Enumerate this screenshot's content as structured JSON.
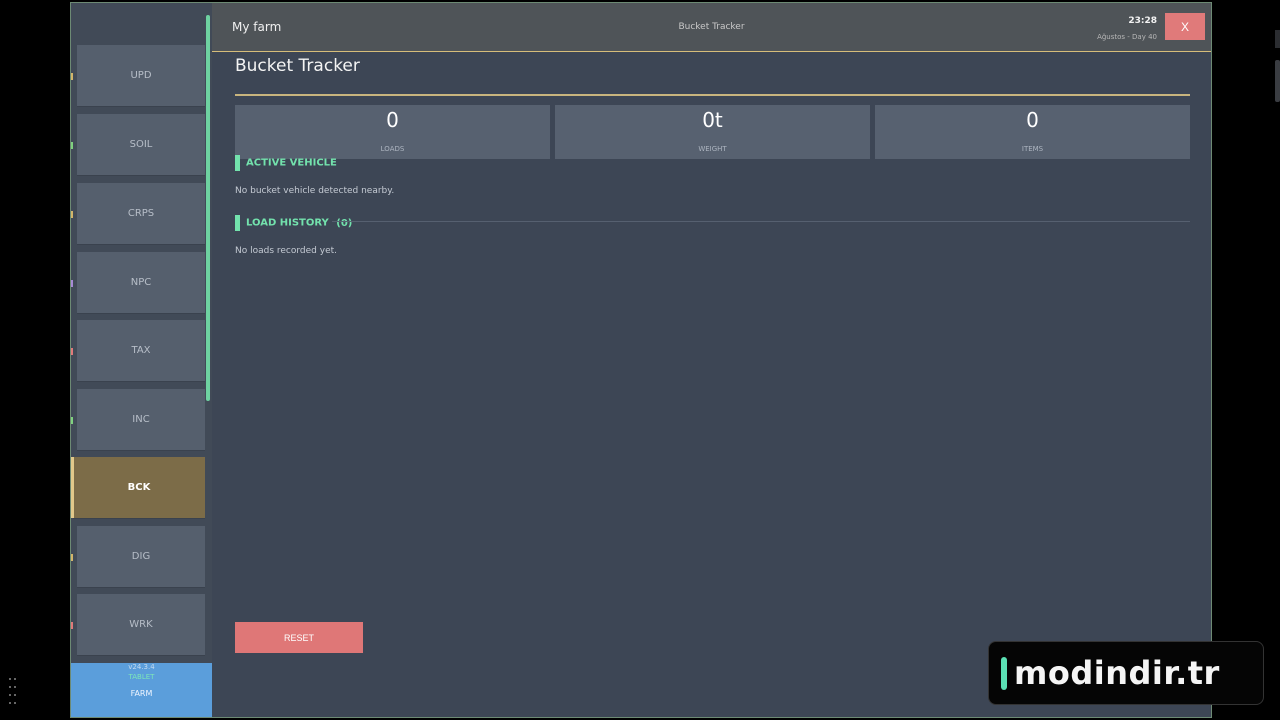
{
  "sidebar": {
    "items": [
      {
        "label": "UPD",
        "color": "#d2b56a"
      },
      {
        "label": "SOIL",
        "color": "#7fd17f"
      },
      {
        "label": "CRPS",
        "color": "#d2b56a"
      },
      {
        "label": "NPC",
        "color": "#a78ad6"
      },
      {
        "label": "TAX",
        "color": "#e07a7a"
      },
      {
        "label": "INC",
        "color": "#7fd17f"
      },
      {
        "label": "BCK",
        "color": "#e1c98b"
      },
      {
        "label": "DIG",
        "color": "#d2b56a"
      },
      {
        "label": "WRK",
        "color": "#e07a7a"
      }
    ],
    "active": "BCK",
    "footer": {
      "version": "v24.3.4",
      "tablet": "TABLET",
      "farm": "FARM"
    }
  },
  "header": {
    "farm_name": "My farm",
    "title": "Bucket Tracker",
    "clock": "23:28",
    "date": "Ağustos - Day 40",
    "close_label": "X"
  },
  "main": {
    "page_title": "Bucket Tracker",
    "stats": [
      {
        "value": "0",
        "label": "LOADS"
      },
      {
        "value": "0t",
        "label": "WEIGHT"
      },
      {
        "value": "0",
        "label": "ITEMS"
      }
    ],
    "active_vehicle": {
      "heading": "ACTIVE VEHICLE",
      "note": "No bucket vehicle detected nearby."
    },
    "load_history": {
      "heading": "LOAD HISTORY",
      "count": "(0)",
      "note": "No loads recorded yet."
    },
    "reset_label": "RESET"
  },
  "watermark": {
    "text": "modindir.tr"
  },
  "colors": {
    "accent": "#73e2ad",
    "gold": "#c9b57e",
    "danger": "#df7777",
    "panel": "#3d4655"
  }
}
